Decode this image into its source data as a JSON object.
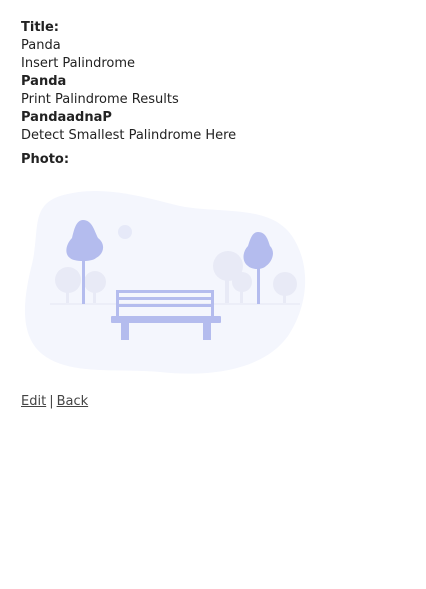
{
  "details": {
    "title_label": "Title:",
    "title_value": "Panda",
    "step1_text": "Insert Palindrome",
    "step1_value": "Panda",
    "step2_text": "Print Palindrome Results",
    "step2_value": "PandaadnaP",
    "step3_text": "Detect Smallest Palindrome Here",
    "photo_label": "Photo:"
  },
  "photo": {
    "icon": "park-bench-illustration",
    "colors": {
      "background_blob": "#f4f6fd",
      "accent": "#b4bcee",
      "faded_tree": "#e8eaf6"
    }
  },
  "links": {
    "edit_label": "Edit",
    "separator": "|",
    "back_label": "Back"
  }
}
